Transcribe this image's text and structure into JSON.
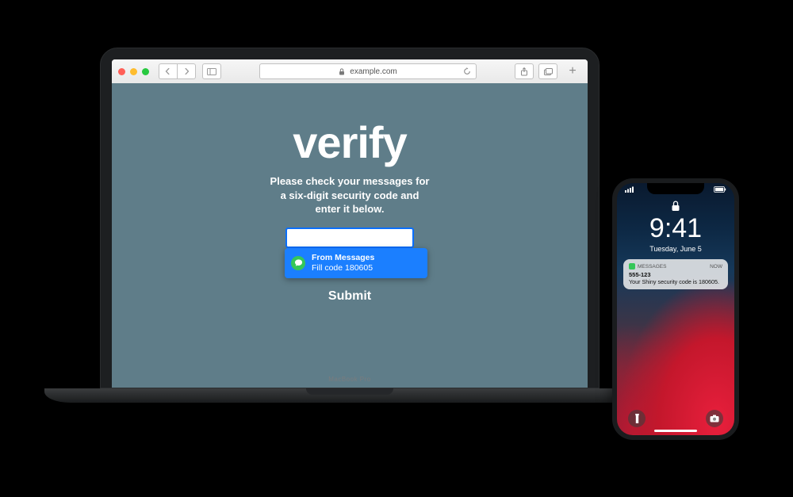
{
  "macbook": {
    "model_label": "MacBook Pro",
    "safari": {
      "url_host": "example.com",
      "page": {
        "title": "verify",
        "subtitle_line1": "Please check your messages for",
        "subtitle_line2": "a six-digit security code and",
        "subtitle_line3": "enter it below.",
        "code_value": "",
        "submit_label": "Submit",
        "autofill": {
          "line1": "From Messages",
          "line2": "Fill code 180605"
        }
      }
    }
  },
  "iphone": {
    "time": "9:41",
    "date": "Tuesday, June 5",
    "notification": {
      "app": "MESSAGES",
      "when": "now",
      "sender": "555-123",
      "body": "Your Shiny security code is 180605."
    }
  }
}
